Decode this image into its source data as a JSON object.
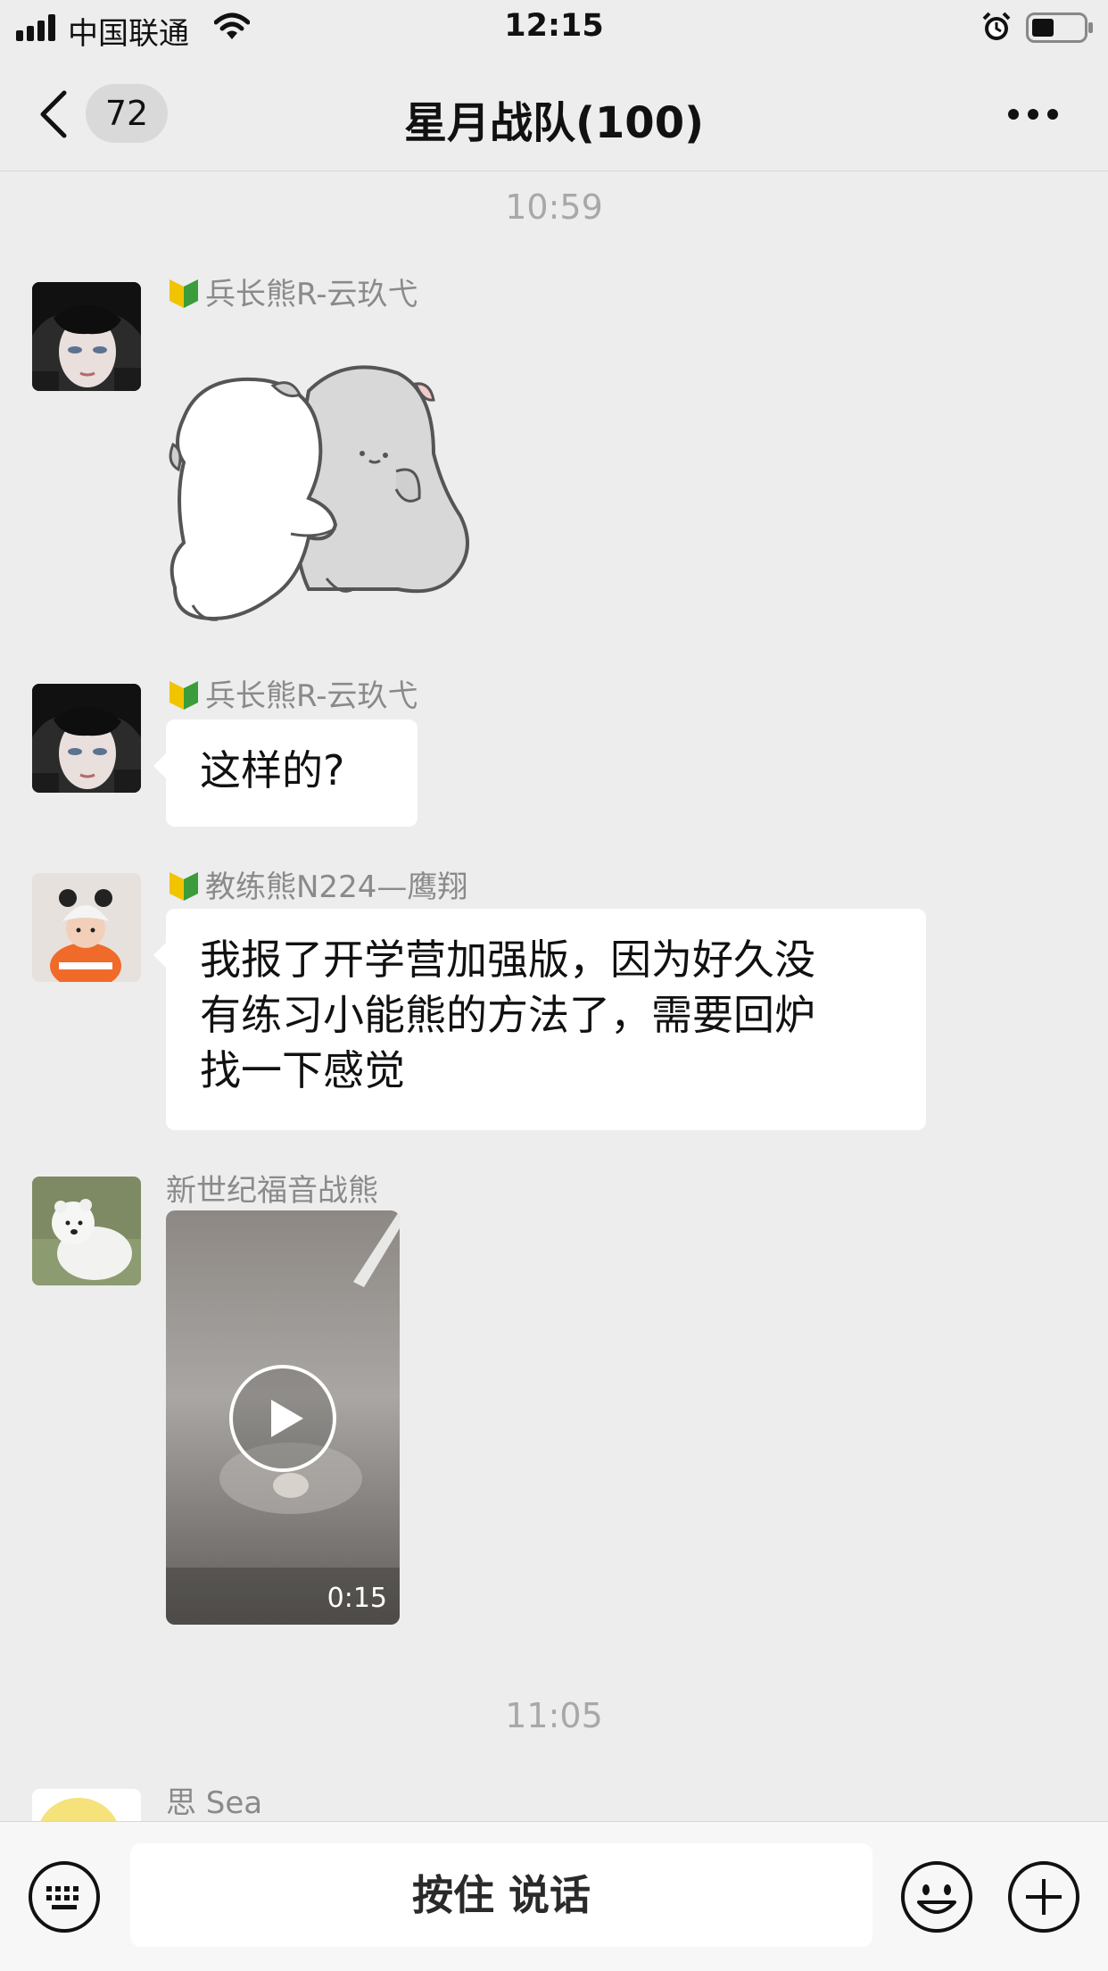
{
  "status_bar": {
    "carrier": "中国联通",
    "time": "12:15"
  },
  "nav": {
    "unread_count": "72",
    "title": "星月战队(100)"
  },
  "chat": {
    "timestamp_1": "10:59",
    "messages": [
      {
        "sender": "兵长熊R-云玖弋",
        "type": "sticker"
      },
      {
        "sender": "兵长熊R-云玖弋",
        "type": "text",
        "lines": [
          "这样的?"
        ]
      },
      {
        "sender": "教练熊N224—鹰翔",
        "type": "text",
        "lines": [
          "我报了开学营加强版，因为好久没",
          "有练习小能熊的方法了，需要回炉",
          "找一下感觉"
        ]
      },
      {
        "sender": "新世纪福音战熊",
        "type": "video",
        "duration": "0:15"
      }
    ],
    "timestamp_2": "11:05",
    "last_sender": "思 Sea"
  },
  "bottom_bar": {
    "hold_to_talk": "按住 说话"
  },
  "colors": {
    "background": "#ededed",
    "bubble": "#ffffff",
    "badge": "#d9d9d9",
    "meta_text": "#8a8a8a"
  },
  "icons": [
    "signal-icon",
    "wifi-icon",
    "alarm-icon",
    "battery-icon",
    "back-chevron-icon",
    "more-icon",
    "keyboard-icon",
    "emoji-icon",
    "plus-icon",
    "play-icon",
    "beginner-flag-icon"
  ]
}
